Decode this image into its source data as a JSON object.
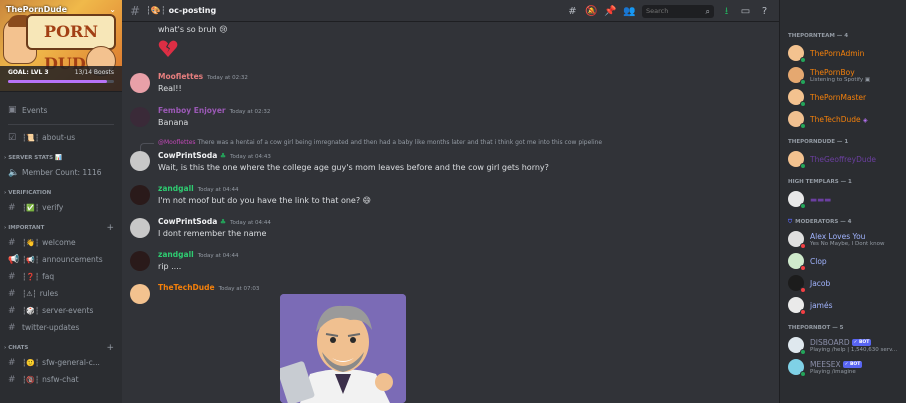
{
  "server": {
    "name": "ThePornDude",
    "banner_text": "PORN DUDE",
    "goal_label": "GOAL: LVL 3",
    "boosts": "13/14 Boosts",
    "boost_progress": 0.93
  },
  "sidebar": {
    "events": "Events",
    "about": "about-us",
    "cat_stats": "SERVER STATS",
    "member_count": "Member Count: 1116",
    "cat_verification": "VERIFICATION",
    "verify": "verify",
    "cat_important": "IMPORTANT",
    "welcome": "welcome",
    "announcements": "announcements",
    "faq": "faq",
    "rules": "rules",
    "server_events": "server-events",
    "twitter": "twitter-updates",
    "cat_chats": "CHATS",
    "sfw": "sfw-general-c...",
    "nsfw": "nsfw-chat"
  },
  "channel": {
    "name": "oc-posting"
  },
  "search": {
    "placeholder": "Search"
  },
  "messages": [
    {
      "text": "what's so bruh 😢"
    },
    {
      "user": "Mooflettes",
      "time": "Today at 02:32",
      "text": "Real!!"
    },
    {
      "user": "Femboy Enjoyer",
      "time": "Today at 02:32",
      "text": "Banana"
    },
    {
      "reply_user": "@Mooflettes",
      "reply_text": "There was a hentai of a cow girl being imregnated and then had a baby like months later and that i think got me into this cow pipeline",
      "user": "CowPrintSoda",
      "time": "Today at 04:43",
      "text": "Wait, is this the one where the college age guy's mom leaves before and the cow girl gets horny?"
    },
    {
      "user": "zandgall",
      "time": "Today at 04:44",
      "text": "I'm not moof but do you have the link to that one? 😄"
    },
    {
      "user": "CowPrintSoda",
      "time": "Today at 04:44",
      "text": "I dont remember the name"
    },
    {
      "user": "zandgall",
      "time": "Today at 04:44",
      "text": "rip ...."
    },
    {
      "user": "TheTechDude",
      "time": "Today at 07:03"
    }
  ],
  "members": {
    "cat_team": "THEPORNTEAM — 4",
    "admin": "ThePornAdmin",
    "boy": "ThePornBoy",
    "boy_act": "Listening to Spotify",
    "master": "ThePornMaster",
    "tech": "TheTechDude",
    "cat_dude": "THEPORNDUDE — 1",
    "geoffrey": "TheGeoffreyDude",
    "cat_high": "HIGH TEMPLARS — 1",
    "cat_mods": "MODERATORS — 4",
    "alex": "Alex Loves You",
    "alex_act": "Yes No Maybe, I Dont know",
    "clop": "Clop",
    "jacob": "Jacob",
    "james": "jamés",
    "cat_bot": "THEPORNBOT — 5",
    "disboard": "DISBOARD",
    "disboard_act": "Playing /help | 1,540,630 serv...",
    "meesex": "MEESEX",
    "meesex_act": "Playing /imagine",
    "bot_tag": "BOT"
  },
  "colors": {
    "accent": "#5865f2",
    "team_orange": "#f4800b",
    "purple_name": "#9b59b6",
    "mod_blue": "#a1b4ff",
    "online": "#23a55a",
    "dnd": "#f23f43"
  }
}
